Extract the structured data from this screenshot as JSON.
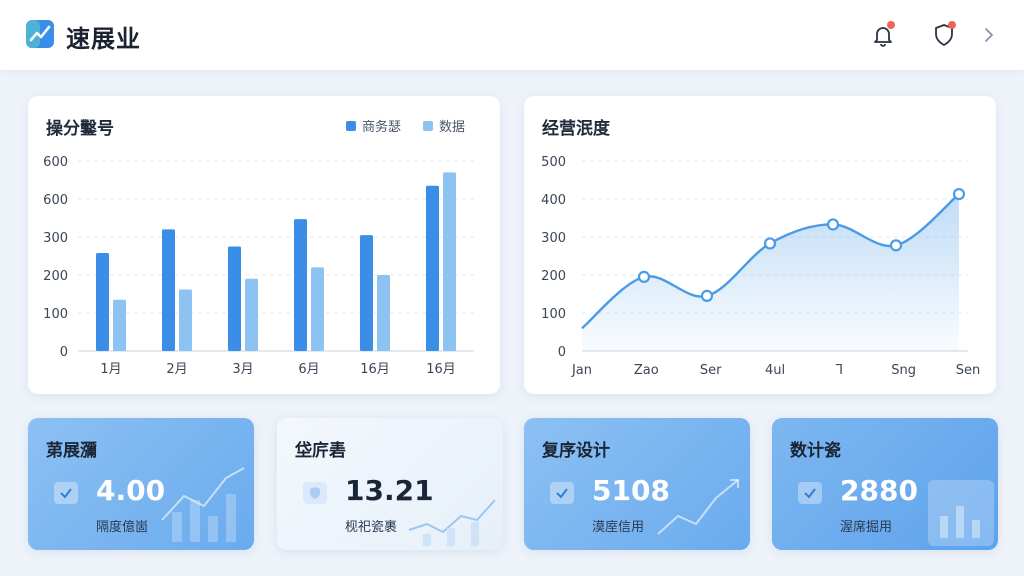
{
  "app": {
    "title": "速展业"
  },
  "icons": {
    "logo": "chart-logo-icon",
    "bell": "bell-icon",
    "shield": "shield-icon",
    "chevron": "chevron-right-icon"
  },
  "colors": {
    "primary": "#3a8ee8",
    "secondary": "#8cc3f3",
    "line": "#4a9be6",
    "alert": "#f0645a"
  },
  "cards": {
    "bar": {
      "title": "操分鑿号",
      "legend": [
        "商务瑟",
        "数据"
      ]
    },
    "line": {
      "title": "经营泯度"
    }
  },
  "stats": [
    {
      "title": "苐展瀰",
      "value": "4.00",
      "sub": "隔度億崮"
    },
    {
      "title": "垈庍砉",
      "value": "13.21",
      "sub": "枧祀瓷裹"
    },
    {
      "title": "复序设计",
      "value": "5108",
      "sub": "漠庢信用"
    },
    {
      "title": "数计瓷",
      "value": "2880",
      "sub": "渥席掘用"
    }
  ],
  "chart_data": [
    {
      "type": "bar",
      "title": "操分鑿号",
      "categories": [
        "1月",
        "2月",
        "3月",
        "6月",
        "16月",
        "16月"
      ],
      "y_ticks": [
        "0",
        "100",
        "200",
        "300",
        "600",
        "600"
      ],
      "ylim": [
        0,
        500
      ],
      "series": [
        {
          "name": "商务瑟",
          "values": [
            258,
            320,
            275,
            347,
            305,
            435
          ]
        },
        {
          "name": "数据",
          "values": [
            135,
            162,
            190,
            220,
            200,
            470
          ]
        }
      ],
      "grid": true,
      "legend": "top-right"
    },
    {
      "type": "area",
      "title": "经营泯度",
      "categories": [
        "Jan",
        "Zao",
        "Ser",
        "4ul",
        "Ꞁ",
        "Sng",
        "Sen"
      ],
      "y_ticks": [
        "0",
        "100",
        "200",
        "300",
        "400",
        "500"
      ],
      "ylim": [
        0,
        500
      ],
      "x": [
        0,
        1,
        2,
        3,
        4,
        5,
        6,
        7
      ],
      "values": [
        60,
        195,
        145,
        283,
        333,
        278,
        413
      ],
      "start_value": 60,
      "grid": true
    }
  ]
}
